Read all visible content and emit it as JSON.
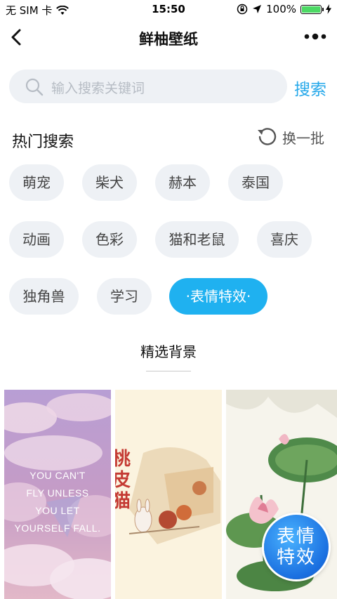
{
  "status_bar": {
    "carrier": "无 SIM 卡",
    "time": "15:50",
    "battery": "100%",
    "battery_level": 1.0
  },
  "nav": {
    "title": "鲜柚壁纸"
  },
  "search": {
    "placeholder": "输入搜索关键词",
    "button": "搜索"
  },
  "hot": {
    "title": "热门搜索",
    "refresh": "换一批",
    "tags": [
      {
        "label": "萌宠"
      },
      {
        "label": "柴犬"
      },
      {
        "label": "赫本"
      },
      {
        "label": "泰国"
      },
      {
        "label": "动画"
      },
      {
        "label": "色彩"
      },
      {
        "label": "猫和老鼠"
      },
      {
        "label": "喜庆"
      },
      {
        "label": "独角兽"
      },
      {
        "label": "学习"
      },
      {
        "label": "·表情特效·"
      }
    ],
    "active_tag": "·表情特效·"
  },
  "section": {
    "title": "精选背景"
  },
  "wallpapers": [
    {
      "text_lines": [
        "YOU CAN'T",
        "FLY UNLESS",
        "YOU LET",
        "YOURSELF FALL."
      ]
    },
    {
      "text_lines": [
        "桃",
        "皮",
        "猫"
      ]
    },
    {
      "text_lines": []
    }
  ],
  "float_button": {
    "line1": "表情",
    "line2": "特效"
  },
  "colors": {
    "accent": "#1fb1f0",
    "chip_bg": "#eef1f5",
    "search_blue": "#25a8ea"
  }
}
